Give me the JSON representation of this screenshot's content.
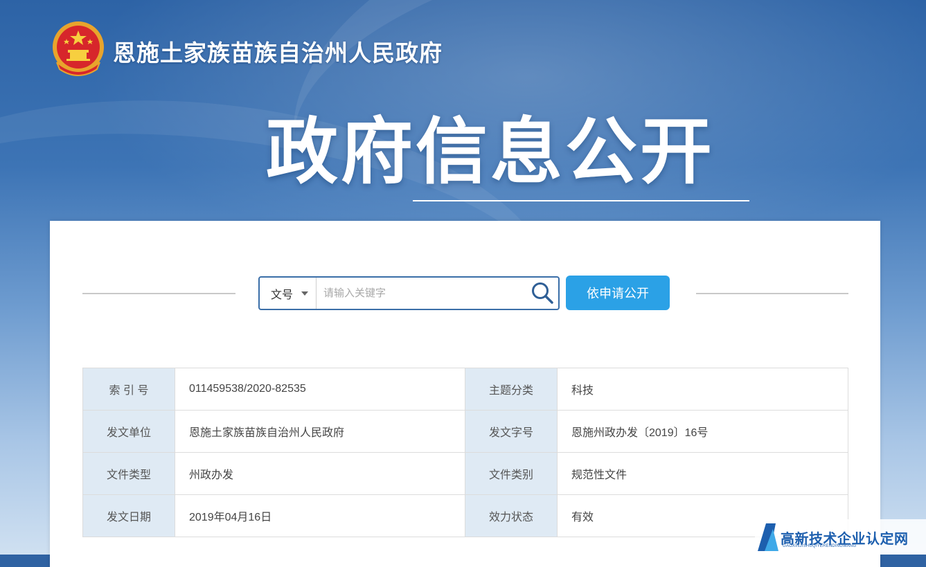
{
  "header": {
    "gov_name": "恩施土家族苗族自治州人民政府",
    "page_title": "政府信息公开"
  },
  "search": {
    "type_label": "文号",
    "placeholder": "请输入关键字",
    "apply_button": "依申请公开"
  },
  "info": {
    "rows": [
      [
        {
          "k": "索 引 号",
          "v": "011459538/2020-82535"
        },
        {
          "k": "主题分类",
          "v": "科技"
        }
      ],
      [
        {
          "k": "发文单位",
          "v": "恩施土家族苗族自治州人民政府"
        },
        {
          "k": "发文字号",
          "v": "恩施州政办发〔2019〕16号"
        }
      ],
      [
        {
          "k": "文件类型",
          "v": "州政办发"
        },
        {
          "k": "文件类别",
          "v": "规范性文件"
        }
      ],
      [
        {
          "k": "发文日期",
          "v": "2019年04月16日"
        },
        {
          "k": "效力状态",
          "v": "有效"
        }
      ]
    ]
  },
  "watermark": {
    "text": "高新技术企业认定网",
    "sub": "GAOXINJISHUQIYERENDINGWANG"
  },
  "colors": {
    "accent": "#2ba1e6",
    "key_cell_bg": "#dfeaf4",
    "search_border": "#3a6ea8"
  },
  "icons": [
    "national-emblem-icon",
    "chevron-down-icon",
    "search-icon",
    "watermark-logo-icon"
  ]
}
